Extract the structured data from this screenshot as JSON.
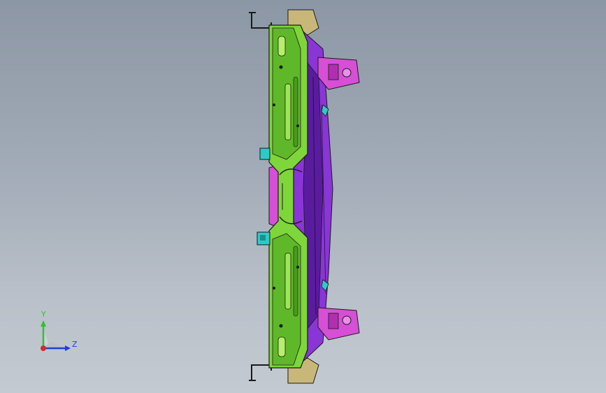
{
  "viewport": {
    "background_top": "#8c97a5",
    "background_bottom": "#c4cad1"
  },
  "model": {
    "part_colors": {
      "main_panel": "#7ed63a",
      "main_panel_shade": "#5fb82a",
      "rib_highlight": "#b6f06a",
      "inner_reinforcement": "#8a35d6",
      "inner_reinforcement_dark": "#5a1c9e",
      "brackets": "#d64fd6",
      "clips": "#2ec9c9",
      "edge_tan": "#c9b77a",
      "outline": "#1a1a1a"
    }
  },
  "triad": {
    "y_label": "Y",
    "z_label": "Z",
    "y_color": "#2fc22f",
    "z_color": "#1f3fd6",
    "x_color": "#d62a2a"
  }
}
